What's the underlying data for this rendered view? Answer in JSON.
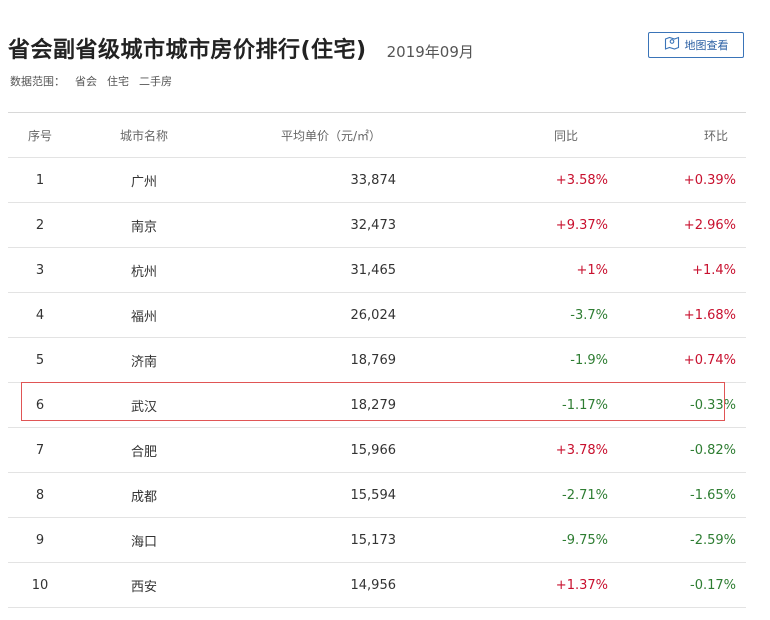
{
  "header": {
    "title": "省会副省级城市城市房价排行(住宅)",
    "date": "2019年09月"
  },
  "map_button": {
    "label": "地图查看",
    "icon": "map-pin-icon"
  },
  "scope": {
    "label": "数据范围：",
    "items": [
      "省会",
      "住宅",
      "二手房"
    ]
  },
  "table": {
    "columns": [
      "序号",
      "城市名称",
      "平均单价（元/㎡）",
      "同比",
      "环比"
    ],
    "rows": [
      {
        "rank": "1",
        "city": "广州",
        "price": "33,874",
        "yoy": "+3.58%",
        "mom": "+0.39%"
      },
      {
        "rank": "2",
        "city": "南京",
        "price": "32,473",
        "yoy": "+9.37%",
        "mom": "+2.96%"
      },
      {
        "rank": "3",
        "city": "杭州",
        "price": "31,465",
        "yoy": "+1%",
        "mom": "+1.4%"
      },
      {
        "rank": "4",
        "city": "福州",
        "price": "26,024",
        "yoy": "-3.7%",
        "mom": "+1.68%"
      },
      {
        "rank": "5",
        "city": "济南",
        "price": "18,769",
        "yoy": "-1.9%",
        "mom": "+0.74%"
      },
      {
        "rank": "6",
        "city": "武汉",
        "price": "18,279",
        "yoy": "-1.17%",
        "mom": "-0.33%"
      },
      {
        "rank": "7",
        "city": "合肥",
        "price": "15,966",
        "yoy": "+3.78%",
        "mom": "-0.82%"
      },
      {
        "rank": "8",
        "city": "成都",
        "price": "15,594",
        "yoy": "-2.71%",
        "mom": "-1.65%"
      },
      {
        "rank": "9",
        "city": "海口",
        "price": "15,173",
        "yoy": "-9.75%",
        "mom": "-2.59%"
      },
      {
        "rank": "10",
        "city": "西安",
        "price": "14,956",
        "yoy": "+1.37%",
        "mom": "-0.17%"
      }
    ]
  },
  "colors": {
    "up": "#c8102e",
    "down": "#2e7d32",
    "highlight": "#e05555",
    "accent": "#3a74b8"
  }
}
